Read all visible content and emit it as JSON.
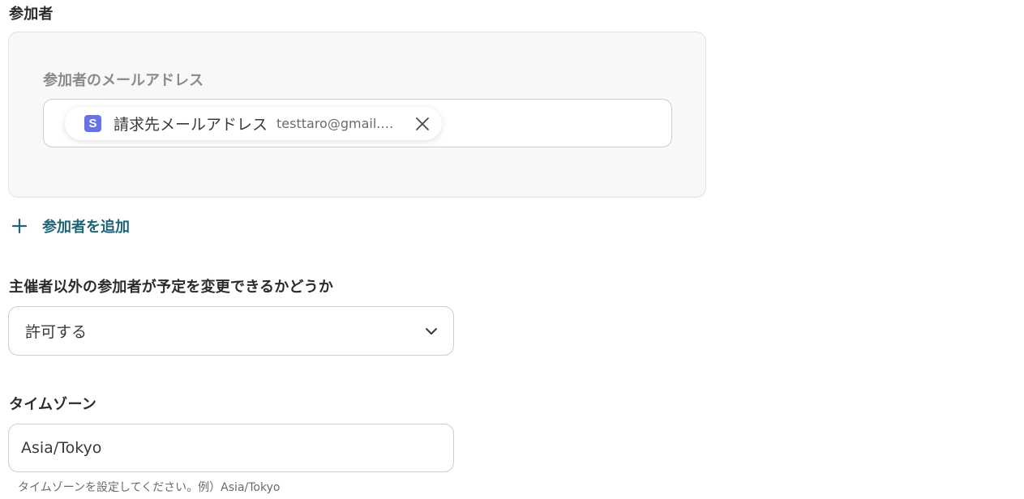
{
  "attendees": {
    "title": "参加者",
    "email_label": "参加者のメールアドレス",
    "chip": {
      "app_icon": "stripe-icon",
      "app_letter": "S",
      "label": "請求先メールアドレス",
      "value": "testtaro@gmail.c..."
    },
    "add_label": "参加者を追加"
  },
  "permission": {
    "title": "主催者以外の参加者が予定を変更できるかどうか",
    "selected": "許可する"
  },
  "timezone": {
    "title": "タイムゾーン",
    "value": "Asia/Tokyo",
    "help": "タイムゾーンを設定してください。例）Asia/Tokyo"
  },
  "colors": {
    "accent": "#1f6478",
    "stripe_brand": "#6772e5",
    "panel_bg": "#f8f8f8",
    "border": "#cfcfcf"
  }
}
